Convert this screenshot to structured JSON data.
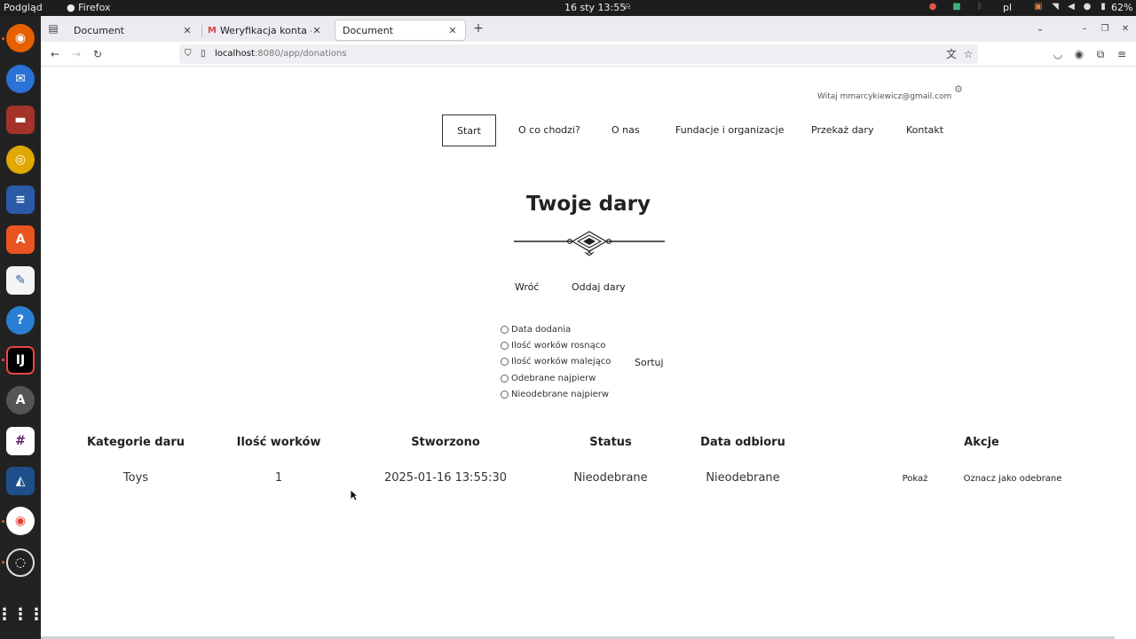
{
  "system": {
    "app_label": "Podgląd",
    "active_app": "Firefox",
    "datetime": "16 sty 13:55",
    "keyboard_layout": "pl",
    "battery": "62%"
  },
  "browser": {
    "tabs": [
      {
        "title": "Document",
        "active": false
      },
      {
        "title": "Weryfikacja konta - mmar",
        "active": false
      },
      {
        "title": "Document",
        "active": true
      }
    ],
    "url_host": "localhost",
    "url_path": ":8080/app/donations"
  },
  "page": {
    "greeting": "Witaj mmarcykiewicz@gmail.com",
    "nav": [
      "Start",
      "O co chodzi?",
      "O nas",
      "Fundacje i organizacje",
      "Przekaż dary",
      "Kontakt"
    ],
    "title": "Twoje dary",
    "actions": {
      "back": "Wróć",
      "donate": "Oddaj dary"
    },
    "sort_options": [
      "Data dodania",
      "Ilość worków rosnąco",
      "Ilość worków malejąco",
      "Odebrane najpierw",
      "Nieodebrane najpierw"
    ],
    "sort_button": "Sortuj",
    "table": {
      "headers": [
        "Kategorie daru",
        "Ilość worków",
        "Stworzono",
        "Status",
        "Data odbioru",
        "Akcje"
      ],
      "rows": [
        {
          "category": "Toys",
          "bags": "1",
          "created": "2025-01-16 13:55:30",
          "status": "Nieodebrane",
          "pickup": "Nieodebrane",
          "show": "Pokaż",
          "mark": "Oznacz jako odebrane"
        }
      ]
    }
  }
}
